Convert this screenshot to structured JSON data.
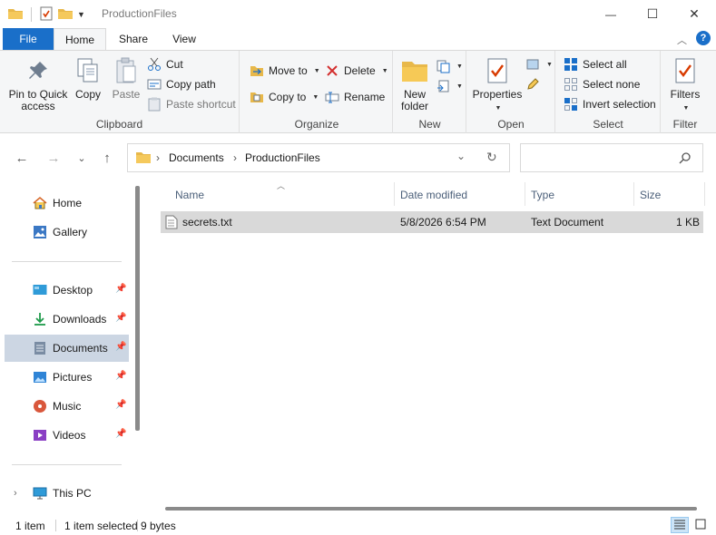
{
  "window": {
    "title": "ProductionFiles",
    "minimize_glyph": "—",
    "maximize_glyph": "☐",
    "close_glyph": "✕"
  },
  "tabs": {
    "file": "File",
    "home": "Home",
    "share": "Share",
    "view": "View"
  },
  "ribbon": {
    "clipboard": {
      "label": "Clipboard",
      "pin": "Pin to Quick access",
      "copy": "Copy",
      "paste": "Paste",
      "cut": "Cut",
      "copy_path": "Copy path",
      "paste_shortcut": "Paste shortcut"
    },
    "organize": {
      "label": "Organize",
      "move_to": "Move to",
      "copy_to": "Copy to",
      "delete": "Delete",
      "rename": "Rename"
    },
    "new": {
      "label": "New",
      "new_folder": "New folder"
    },
    "open": {
      "label": "Open",
      "properties": "Properties"
    },
    "select": {
      "label": "Select",
      "select_all": "Select all",
      "select_none": "Select none",
      "invert": "Invert selection"
    },
    "filter": {
      "label": "Filter",
      "filters": "Filters"
    }
  },
  "address": {
    "crumbs": [
      "Documents",
      "ProductionFiles"
    ],
    "separator": "›"
  },
  "search": {
    "placeholder": ""
  },
  "nav": {
    "items": [
      {
        "label": "Home",
        "icon": "home-icon"
      },
      {
        "label": "Gallery",
        "icon": "gallery-icon"
      },
      {
        "label": "Desktop",
        "icon": "desktop-icon",
        "pinned": true
      },
      {
        "label": "Downloads",
        "icon": "download-icon",
        "pinned": true
      },
      {
        "label": "Documents",
        "icon": "documents-icon",
        "pinned": true,
        "selected": true
      },
      {
        "label": "Pictures",
        "icon": "pictures-icon",
        "pinned": true
      },
      {
        "label": "Music",
        "icon": "music-icon",
        "pinned": true
      },
      {
        "label": "Videos",
        "icon": "videos-icon",
        "pinned": true
      },
      {
        "label": "This PC",
        "icon": "this-pc-icon"
      }
    ]
  },
  "filelist": {
    "columns": [
      "Name",
      "Date modified",
      "Type",
      "Size"
    ],
    "rows": [
      {
        "name": "secrets.txt",
        "modified": "5/8/2026 6:54 PM",
        "type": "Text Document",
        "size": "1 KB"
      }
    ]
  },
  "status": {
    "count": "1 item",
    "selected": "1 item selected",
    "size": "9 bytes"
  },
  "colors": {
    "accent": "#1a6fc9",
    "selection": "#d9d9d9",
    "nav_selected": "#ccd6e3"
  }
}
